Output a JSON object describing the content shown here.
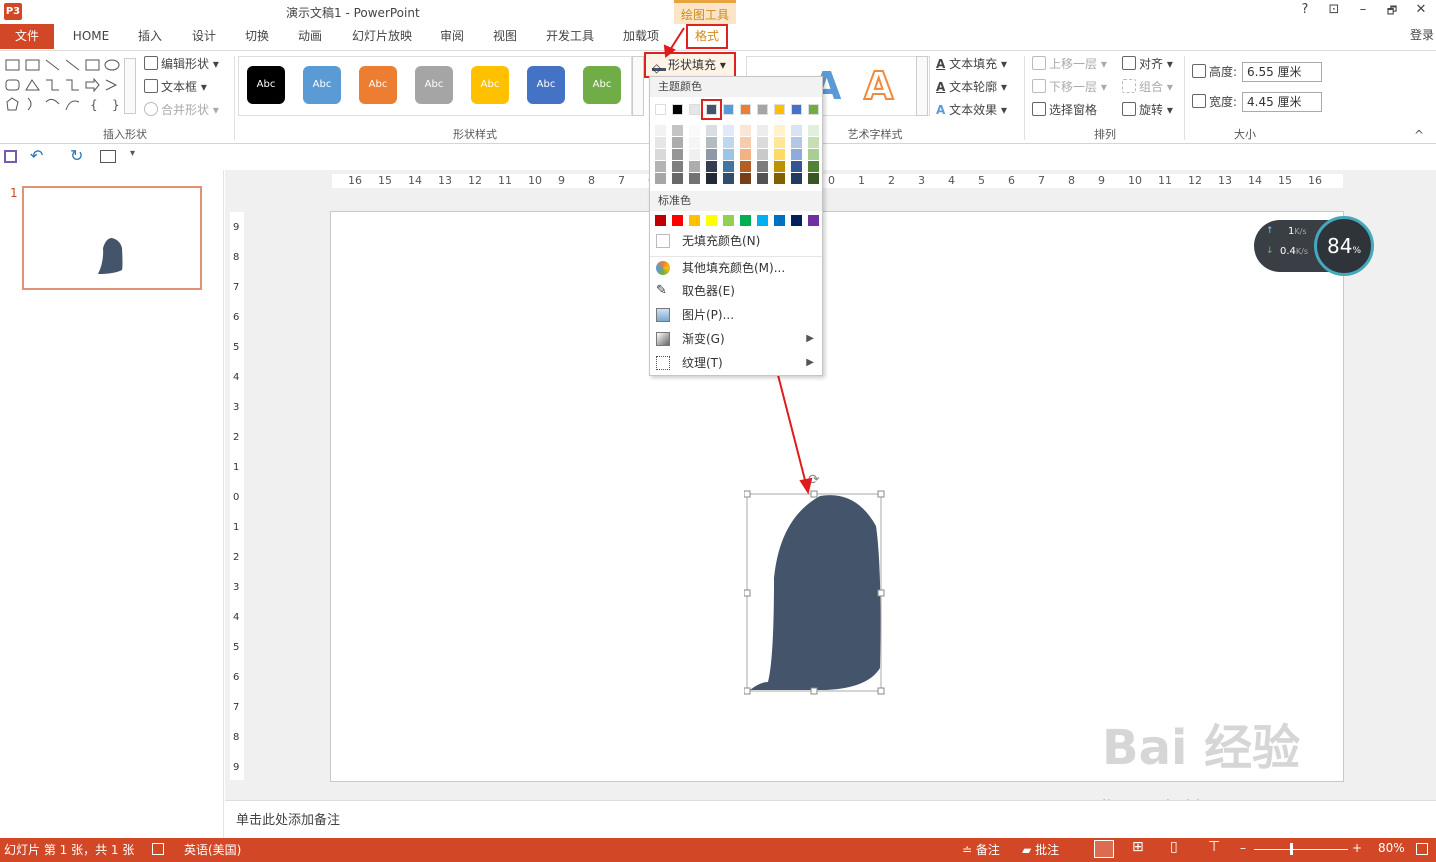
{
  "window": {
    "title": "演示文稿1 - PowerPoint",
    "app_icon": "P3",
    "help": "?",
    "restore_ribbon": "⊡",
    "minimize": "–",
    "maximize": "🗗",
    "close": "✕"
  },
  "contextual": {
    "label": "绘图工具"
  },
  "tabs": {
    "file": "文件",
    "items": [
      "HOME",
      "插入",
      "设计",
      "切换",
      "动画",
      "幻灯片放映",
      "审阅",
      "视图",
      "开发工具",
      "加载项"
    ],
    "format": "格式",
    "login": "登录"
  },
  "ribbon": {
    "insert_shapes": {
      "label": "插入形状",
      "edit_shape": "编辑形状",
      "text_box": "文本框",
      "merge_shapes": "合并形状"
    },
    "shape_styles": {
      "label": "形状样式",
      "fill": "形状填充",
      "sample": "Abc",
      "colors": [
        "#000000",
        "#5b9bd5",
        "#ed7d31",
        "#a5a5a5",
        "#ffc000",
        "#4472c4",
        "#70ad47"
      ]
    },
    "wordart": {
      "label": "艺术字样式",
      "letter": "A",
      "text_fill": "文本填充",
      "text_outline": "文本轮廓",
      "text_effects": "文本效果"
    },
    "arrange": {
      "label": "排列",
      "bring_forward": "上移一层",
      "send_backward": "下移一层",
      "selection_pane": "选择窗格",
      "align": "对齐",
      "group": "组合",
      "rotate": "旋转"
    },
    "size": {
      "label": "大小",
      "height_label": "高度:",
      "height_value": "6.55 厘米",
      "width_label": "宽度:",
      "width_value": "4.45 厘米"
    }
  },
  "dropdown": {
    "theme_colors_label": "主题颜色",
    "theme_top": [
      "#ffffff",
      "#000000",
      "#e7e6e6",
      "#44546a",
      "#5b9bd5",
      "#ed7d31",
      "#a5a5a5",
      "#ffc000",
      "#4472c4",
      "#70ad47"
    ],
    "standard_label": "标准色",
    "standard": [
      "#c00000",
      "#ff0000",
      "#ffc000",
      "#ffff00",
      "#92d050",
      "#00b050",
      "#00b0f0",
      "#0070c0",
      "#002060",
      "#7030a0"
    ],
    "no_fill": "无填充颜色(N)",
    "more_colors": "其他填充颜色(M)...",
    "eyedropper": "取色器(E)",
    "picture": "图片(P)...",
    "gradient": "渐变(G)",
    "texture": "纹理(T)"
  },
  "ruler": {
    "h_ticks": [
      "16",
      "15",
      "14",
      "13",
      "12",
      "11",
      "10",
      "9",
      "8",
      "7",
      "6",
      "5",
      "4",
      "3",
      "2",
      "1",
      "0",
      "1",
      "2",
      "3",
      "4",
      "5",
      "6",
      "7",
      "8",
      "9",
      "10",
      "11",
      "12",
      "13",
      "14",
      "15",
      "16"
    ],
    "v_ticks": [
      "9",
      "8",
      "7",
      "6",
      "5",
      "4",
      "3",
      "2",
      "1",
      "0",
      "1",
      "2",
      "3",
      "4",
      "5",
      "6",
      "7",
      "8",
      "9"
    ]
  },
  "slides": {
    "number": "1"
  },
  "shape": {
    "fill": "#44546a"
  },
  "notes": {
    "placeholder": "单击此处添加备注"
  },
  "speed": {
    "up": "1",
    "down": "0.4",
    "unit": "K/s",
    "percent": "84",
    "pct_sign": "%"
  },
  "watermark": {
    "brand": "Bai 经验",
    "url": "jingyan.baidu.com"
  },
  "status": {
    "slide_info": "幻灯片 第 1 张，共 1 张",
    "language": "英语(美国)",
    "notes": "备注",
    "comments": "批注",
    "zoom": "80%"
  }
}
